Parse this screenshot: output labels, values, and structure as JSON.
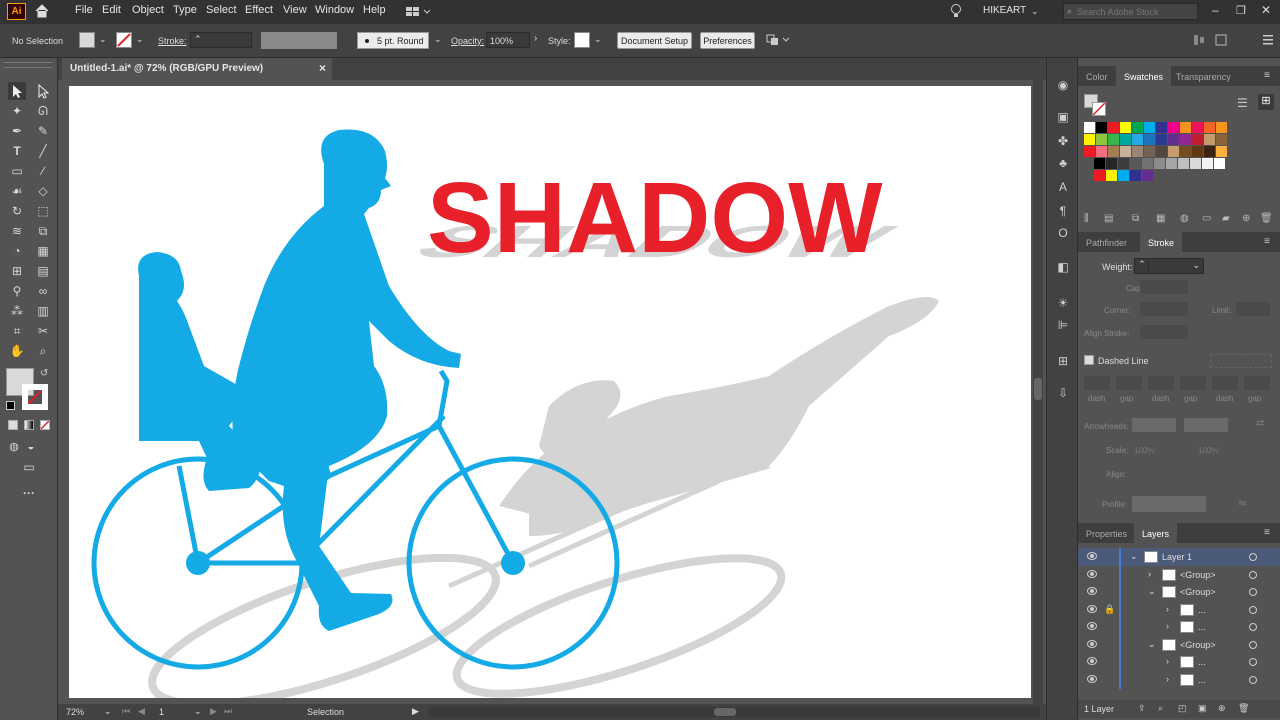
{
  "app": {
    "logo": "Ai",
    "account": "HIKEART",
    "search_placeholder": "Search Adobe Stock"
  },
  "menu": [
    "File",
    "Edit",
    "Object",
    "Type",
    "Select",
    "Effect",
    "View",
    "Window",
    "Help"
  ],
  "control": {
    "selection": "No Selection",
    "stroke_label": "Stroke:",
    "brush": "5 pt. Round",
    "opacity_label": "Opacity:",
    "opacity": "100%",
    "style_label": "Style:",
    "doc_setup": "Document Setup",
    "preferences": "Preferences"
  },
  "document": {
    "tab": "Untitled-1.ai* @ 72% (RGB/GPU Preview)",
    "close": "×"
  },
  "artwork": {
    "headline": "SHADOW",
    "headline_color": "#e8202a",
    "figure_color": "#14aae6",
    "shadow_color": "#d4d4d4"
  },
  "status": {
    "zoom": "72%",
    "artboard": "1",
    "tool": "Selection"
  },
  "panels": {
    "top_tabs": [
      "Color",
      "Swatches",
      "Transparency"
    ],
    "active_top": "Swatches",
    "stroke_tabs": [
      "Pathfinder",
      "Stroke"
    ],
    "stroke": {
      "weight_label": "Weight:",
      "cap_label": "Cap:",
      "corner_label": "Corner:",
      "limit_label": "Limit:",
      "align_label": "Align Stroke:",
      "dashed_label": "Dashed Line",
      "dash_labels": [
        "dash",
        "gap",
        "dash",
        "gap",
        "dash",
        "gap"
      ],
      "arrowheads_label": "Arrowheads:",
      "scale_label": "Scale:",
      "scale1": "100%",
      "scale2": "100%",
      "align2_label": "Align:",
      "profile_label": "Profile:"
    },
    "layers_tabs": [
      "Properties",
      "Layers"
    ],
    "layers": [
      {
        "name": "Layer 1",
        "depth": 0,
        "expanded": true
      },
      {
        "name": "<Group>",
        "depth": 1,
        "expanded": false
      },
      {
        "name": "<Group>",
        "depth": 1,
        "expanded": true
      },
      {
        "name": "...",
        "depth": 2,
        "expanded": false,
        "locked": true
      },
      {
        "name": "...",
        "depth": 2,
        "expanded": false
      },
      {
        "name": "<Group>",
        "depth": 1,
        "expanded": true
      },
      {
        "name": "...",
        "depth": 2,
        "expanded": false
      },
      {
        "name": "...",
        "depth": 2,
        "expanded": false
      }
    ],
    "layers_count": "1 Layer"
  },
  "swatch_colors": [
    [
      "#ffffff",
      "#000000",
      "#ed1c24",
      "#ffff00",
      "#00a651",
      "#00aeef",
      "#2e3192",
      "#ec008c",
      "#f7941d",
      "#ed145b",
      "#f26522",
      "#f7941d"
    ],
    [
      "#fff200",
      "#8dc63f",
      "#39b54a",
      "#00a99d",
      "#27aae1",
      "#1c75bc",
      "#2b3990",
      "#662d91",
      "#92278f",
      "#be1e2d",
      "#c49a6c",
      "#8c6239"
    ],
    [
      "#ed1c24",
      "#f26d7d",
      "#a67c52",
      "#c7b299",
      "#998675",
      "#736357",
      "#534741",
      "#c69c6d",
      "#754c24",
      "#603913",
      "#3c2415",
      "#fbb040"
    ],
    [
      "#000000",
      "#262626",
      "#3d3d3d",
      "#595959",
      "#737373",
      "#8c8c8c",
      "#a6a6a6",
      "#bfbfbf",
      "#d9d9d9",
      "#f2f2f2",
      "#ffffff"
    ],
    [
      "#ed1c24",
      "#fff200",
      "#00aeef",
      "#2e3192",
      "#662d91"
    ]
  ]
}
